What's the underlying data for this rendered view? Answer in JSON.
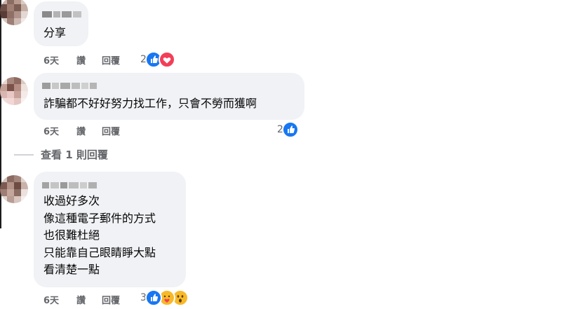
{
  "comments": [
    {
      "text": "分享",
      "time": "6天",
      "like_label": "讚",
      "reply_label": "回覆",
      "reaction_count": "2",
      "reactions": [
        "like-reaction",
        "love-reaction"
      ]
    },
    {
      "text": "詐騙都不好好努力找工作，只會不勞而獲啊",
      "time": "6天",
      "like_label": "讚",
      "reply_label": "回覆",
      "reaction_count": "2",
      "reactions": [
        "like-reaction"
      ]
    },
    {
      "text": "收過好多次\n像這種電子郵件的方式\n也很難杜絕\n只能靠自己眼睛睜大點\n看清楚一點",
      "time": "6天",
      "like_label": "讚",
      "reply_label": "回覆",
      "reaction_count": "3",
      "reactions": [
        "like-reaction",
        "care-reaction",
        "wow-reaction"
      ]
    }
  ],
  "view_replies_label": "查看 1 則回覆",
  "colors": {
    "bubble": "#f0f2f5",
    "meta_text": "#65676b",
    "like_blue": "#1877f2",
    "love_red": "#f33e58",
    "wow_yellow": "#f7b928"
  }
}
